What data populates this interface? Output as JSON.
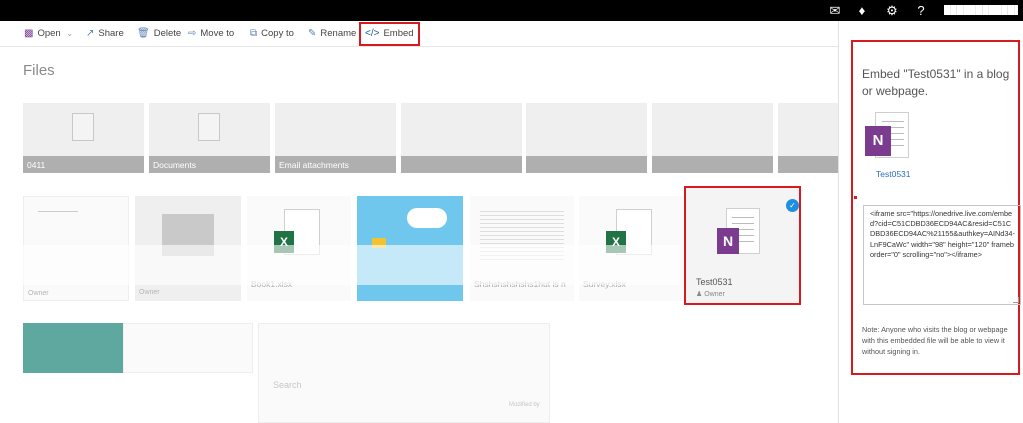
{
  "topbar": {
    "icons": [
      {
        "name": "chat-icon",
        "glyph": "💬"
      },
      {
        "name": "bell-icon",
        "glyph": "🔔"
      },
      {
        "name": "gear-icon",
        "glyph": "⚙"
      },
      {
        "name": "help-icon",
        "glyph": "?"
      }
    ],
    "user_name": "████████████"
  },
  "commands": {
    "open": "Open",
    "share": "Share",
    "delete": "Delete",
    "move_to": "Move to",
    "copy_to": "Copy to",
    "rename": "Rename",
    "embed": "Embed"
  },
  "main": {
    "title": "Files",
    "folders": [
      "0411",
      "Documents",
      "Email attachments",
      "",
      "",
      "",
      ""
    ],
    "files": [
      {
        "label": "",
        "owner": "Owner"
      },
      {
        "label": "",
        "owner": "Owner"
      },
      {
        "label": "Book1.xlsx",
        "owner": ""
      },
      {
        "label": "",
        "owner": ""
      },
      {
        "label": "Shshshshshshs1hut is n",
        "owner": ""
      },
      {
        "label": "Survey.xlsx",
        "owner": ""
      }
    ],
    "selected_file": {
      "label": "Test0531",
      "owner": "Owner"
    },
    "bottom_labels": {
      "search": "Search",
      "modified_by": "Modified by"
    }
  },
  "panel": {
    "title": "Embed \"Test0531\" in a blog or webpage.",
    "file_name": "Test0531",
    "embed_code": "<iframe src=\"https://onedrive.live.com/embed?cid=C51CDBD36ECD94AC&resid=C51CDBD36ECD94AC%21155&authkey=AINd34-LnF9CaWc\" width=\"98\" height=\"120\" frameborder=\"0\" scrolling=\"no\"></iframe>",
    "note": "Note: Anyone who visits the blog or webpage with this embedded file will be able to view it without signing in."
  },
  "colors": {
    "accent_red": "#d71920",
    "onenote_purple": "#7b3c8f",
    "excel_green": "#217346",
    "link_blue": "#2a6ebb"
  }
}
